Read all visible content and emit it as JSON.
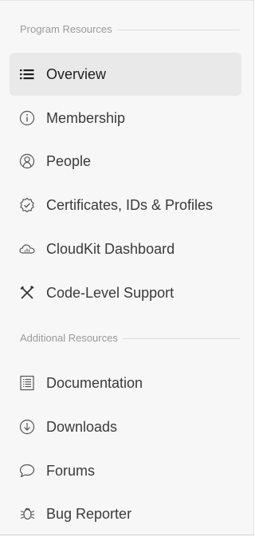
{
  "sidebar": {
    "program_section": {
      "title": "Program Resources",
      "items": [
        {
          "label": "Overview",
          "icon": "list-icon",
          "active": true
        },
        {
          "label": "Membership",
          "icon": "info-circle-icon"
        },
        {
          "label": "People",
          "icon": "person-circle-icon"
        },
        {
          "label": "Certificates, IDs & Profiles",
          "icon": "badge-check-icon"
        },
        {
          "label": "CloudKit Dashboard",
          "icon": "cloud-chart-icon"
        },
        {
          "label": "Code-Level Support",
          "icon": "tools-icon"
        }
      ]
    },
    "additional_section": {
      "title": "Additional Resources",
      "items": [
        {
          "label": "Documentation",
          "icon": "document-list-icon"
        },
        {
          "label": "Downloads",
          "icon": "download-circle-icon"
        },
        {
          "label": "Forums",
          "icon": "speech-bubble-icon"
        },
        {
          "label": "Bug Reporter",
          "icon": "bug-icon"
        }
      ]
    }
  }
}
